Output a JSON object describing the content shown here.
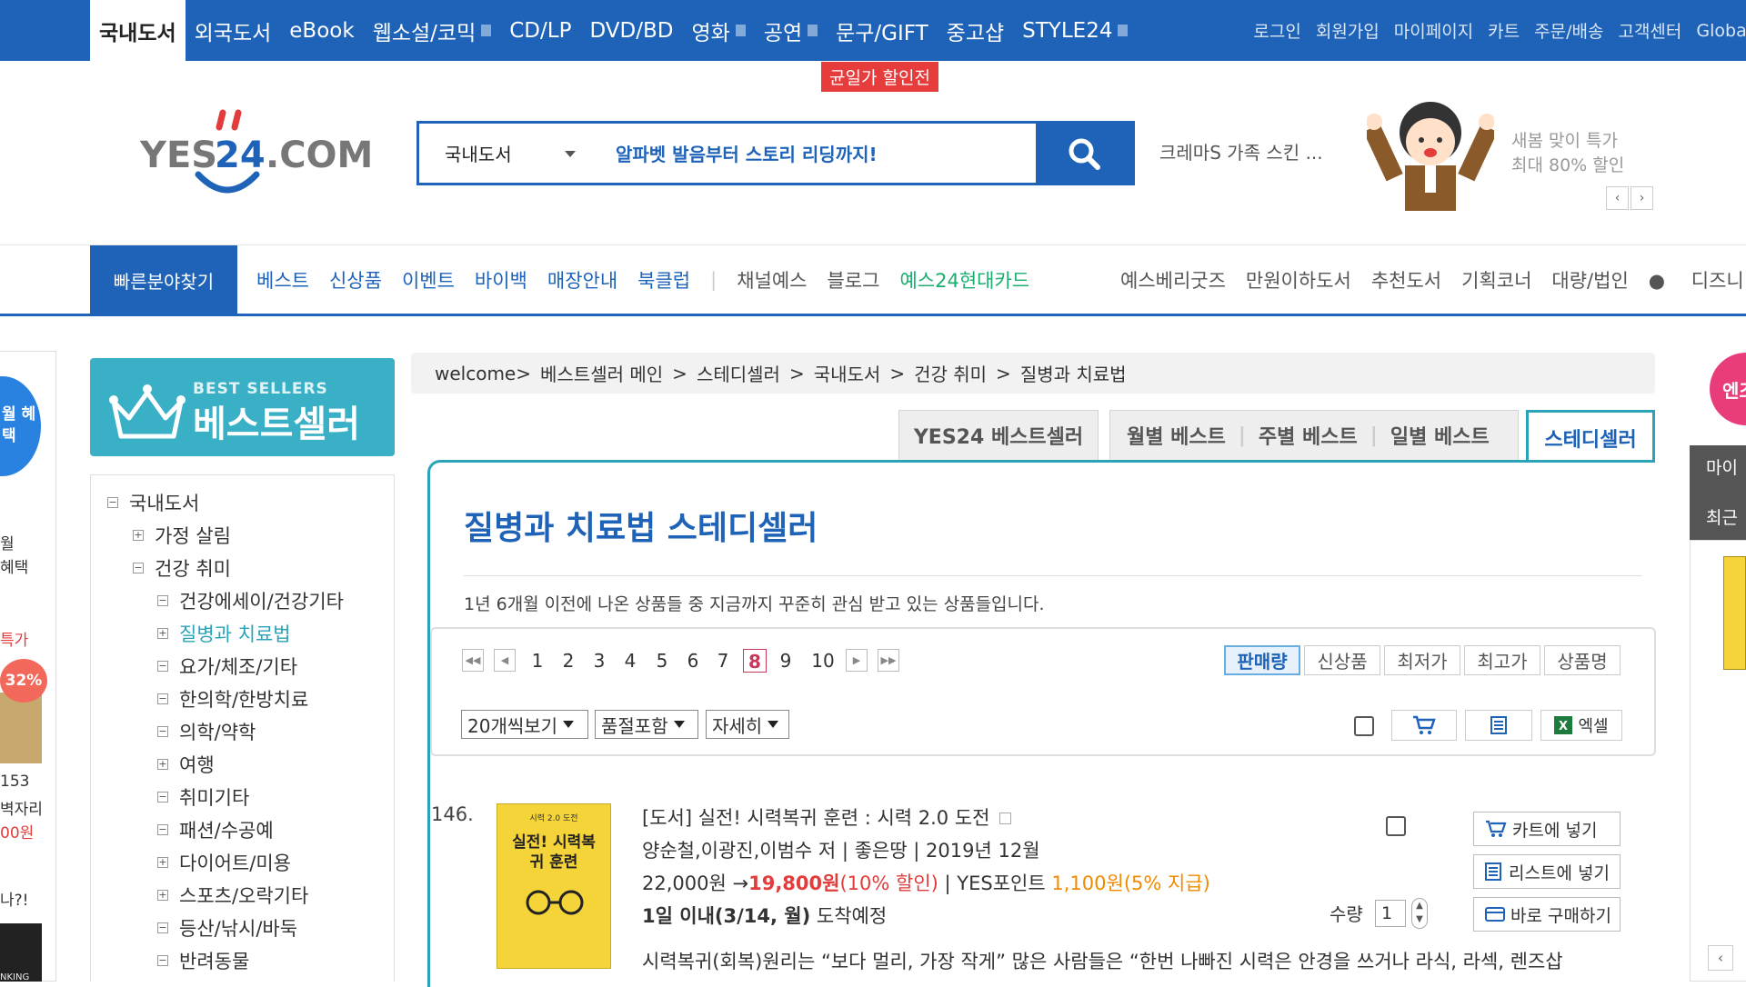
{
  "topnav": {
    "items": [
      "국내도서",
      "외국도서",
      "eBook",
      "웹소설/코믹",
      "CD/LP",
      "DVD/BD",
      "영화",
      "공연",
      "문구/GIFT",
      "중고샵",
      "STYLE24"
    ],
    "utils": [
      "로그인",
      "회원가입",
      "마이페이지",
      "카트",
      "주문/배송",
      "고객센터",
      "Global"
    ],
    "promo_badge": "균일가 할인전"
  },
  "header": {
    "logo_text": "YES24.COM",
    "search_category": "국내도서",
    "search_value": "알파벳 발음부터 스토리 리딩까지!",
    "keyword_ad": "크레마S 가족 스킨 ...",
    "ad_line1": "새봄 맞이 특가",
    "ad_line2": "최대 80% 할인"
  },
  "nav2": {
    "quick": "빠른분야찾기",
    "left_blue": [
      "베스트",
      "신상품",
      "이벤트",
      "바이백",
      "매장안내",
      "북클럽"
    ],
    "left_gray": [
      "채널예스",
      "블로그"
    ],
    "green": "예스24현대카드",
    "right": [
      "예스베리굿즈",
      "만원이하도서",
      "추천도서",
      "기획코너",
      "대량/법인",
      "디즈니"
    ]
  },
  "edge": {
    "circle": "월 혜택",
    "t1": "월",
    "t2": "혜택",
    "t3": "특가",
    "badge": "32%",
    "t4": "153",
    "t5": "벽자리",
    "t6": "00원",
    "t7": "나?!",
    "book": "NKING"
  },
  "sidebar": {
    "banner_en": "BEST SELLERS",
    "banner_ko": "베스트셀러",
    "tree": [
      {
        "label": "국내도서",
        "sign": "−"
      },
      {
        "label": "가정 살림",
        "sign": "+"
      },
      {
        "label": "건강 취미",
        "sign": "−"
      },
      {
        "label": "건강에세이/건강기타",
        "sign": "−"
      },
      {
        "label": "질병과 치료법",
        "sign": "+"
      },
      {
        "label": "요가/체조/기타",
        "sign": "−"
      },
      {
        "label": "한의학/한방치료",
        "sign": "−"
      },
      {
        "label": "의학/약학",
        "sign": "−"
      },
      {
        "label": "여행",
        "sign": "+"
      },
      {
        "label": "취미기타",
        "sign": "−"
      },
      {
        "label": "패션/수공예",
        "sign": "−"
      },
      {
        "label": "다이어트/미용",
        "sign": "+"
      },
      {
        "label": "스포츠/오락기타",
        "sign": "+"
      },
      {
        "label": "등산/낚시/바둑",
        "sign": "−"
      },
      {
        "label": "반려동물",
        "sign": "−"
      }
    ]
  },
  "breadcrumb": [
    "welcome>",
    "베스트셀러 메인",
    ">",
    "스테디셀러",
    ">",
    "국내도서",
    ">",
    "건강 취미",
    ">",
    "질병과 치료법"
  ],
  "tabs": {
    "yes24": "YES24 베스트셀러",
    "monthly": "월별 베스트",
    "weekly": "주별 베스트",
    "daily": "일별 베스트",
    "steady": "스테디셀러"
  },
  "page": {
    "title": "질병과 치료법 스테디셀러",
    "desc": "1년 6개월 이전에 나온 상품들 중 지금까지 꾸준히 관심 받고 있는 상품들입니다."
  },
  "pagination": {
    "pages": [
      "1",
      "2",
      "3",
      "4",
      "5",
      "6",
      "7",
      "8",
      "9",
      "10"
    ],
    "current": "8"
  },
  "sort": [
    "판매량",
    "신상품",
    "최저가",
    "최고가",
    "상품명"
  ],
  "selects": {
    "per_page": "20개씩보기",
    "soldout": "품절포함",
    "view": "자세히"
  },
  "tools": {
    "excel": "엑셀"
  },
  "product": {
    "rank": "146.",
    "cover_title_small": "시력 2.0 도전",
    "cover_title": "실전! 시력복귀 훈련",
    "title": "[도서] 실전! 시력복귀 훈련 : 시력 2.0 도전",
    "authors": "양순철,이광진,이범수 저 | 좋은땅 | 2019년 12월",
    "price_orig": "22,000원",
    "arrow": "→",
    "price_sale": "19,800원",
    "discount": "(10% 할인)",
    "points_label": "| YES포인트",
    "points": "1,100원",
    "points_rate": "(5% 지급)",
    "delivery_bold": "1일 이내(3/14, 월)",
    "delivery": "도착예정",
    "summary": "시력복귀(회복)원리는 “보다 멀리, 가장 작게” 많은 사람들은 “한번 나빠진 시력은 안경을 쓰거나 라식, 라섹, 렌즈삽",
    "qty_label": "수량",
    "qty": "1",
    "cart_btn": "카트에 넣기",
    "list_btn": "리스트에 넣기",
    "buy_btn": "바로 구매하기"
  },
  "right_edge": {
    "heart": "엔조",
    "t1": "마이",
    "t2": "최근"
  }
}
